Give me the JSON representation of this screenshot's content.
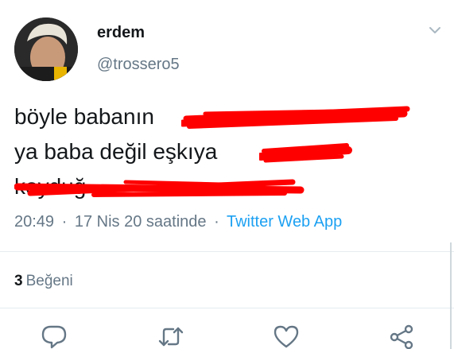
{
  "user": {
    "display_name": "erdem",
    "handle": "@trossero5"
  },
  "tweet": {
    "lines": [
      "böyle babanın",
      "ya baba değil eşkıya",
      "koyduğ"
    ]
  },
  "meta": {
    "time": "20:49",
    "date": "17 Nis 20 saatinde",
    "separator": "·",
    "source": "Twitter Web App"
  },
  "stats": {
    "likes_count": "3",
    "likes_label": "Beğeni"
  },
  "actions": {
    "reply_icon": "reply-icon",
    "retweet_icon": "retweet-icon",
    "like_icon": "like-icon",
    "share_icon": "share-icon"
  },
  "colors": {
    "text": "#14171a",
    "secondary": "#657786",
    "link": "#1da1f2",
    "redaction": "#ff0000"
  }
}
